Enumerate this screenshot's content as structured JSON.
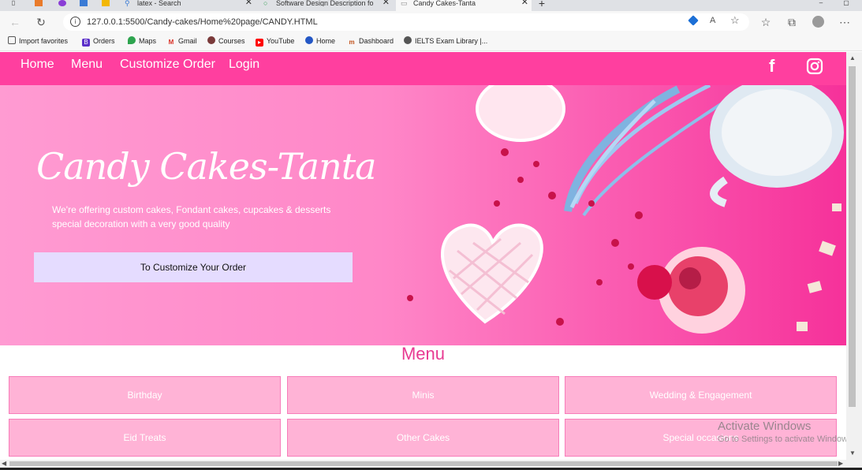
{
  "browser": {
    "tabs": [
      {
        "label": "latex - Search"
      },
      {
        "label": "Software Design Description for"
      },
      {
        "label": "Candy Cakes-Tanta"
      }
    ],
    "url": "127.0.0.1:5500/Candy-cakes/Home%20page/CANDY.HTML",
    "bookmarks": [
      {
        "label": "Import favorites",
        "icon": "import-icon"
      },
      {
        "label": "Orders",
        "icon": "b-icon"
      },
      {
        "label": "Maps",
        "icon": "maps-pin-icon"
      },
      {
        "label": "Gmail",
        "icon": "gmail-icon"
      },
      {
        "label": "Courses",
        "icon": "courses-icon"
      },
      {
        "label": "YouTube",
        "icon": "youtube-icon"
      },
      {
        "label": "Home",
        "icon": "home-icon"
      },
      {
        "label": "Dashboard",
        "icon": "dashboard-icon"
      },
      {
        "label": "IELTS Exam Library |...",
        "icon": "ielts-icon"
      }
    ]
  },
  "nav": {
    "links": [
      "Home",
      "Menu",
      "Customize Order",
      "Login"
    ],
    "social": [
      {
        "icon": "facebook-icon",
        "glyph": "f"
      },
      {
        "icon": "instagram-icon"
      }
    ]
  },
  "hero": {
    "title": "Candy Cakes-Tanta",
    "subtitle": "We're offering custom cakes, Fondant cakes, cupcakes & desserts special decoration with a very good quality",
    "button": "To Customize Your Order"
  },
  "menu": {
    "title": "Menu",
    "items": [
      "Birthday",
      "Minis",
      "Wedding & Engagement",
      "Eid Treats",
      "Other Cakes",
      "Special occasions"
    ]
  },
  "watermark": {
    "line1": "Activate Windows",
    "line2": "Go to Settings to activate Windows."
  },
  "colors": {
    "nav": "#ff3f9f",
    "button": "#e5dcff",
    "card": "#ffb3d6",
    "menuTitle": "#e83a92"
  }
}
